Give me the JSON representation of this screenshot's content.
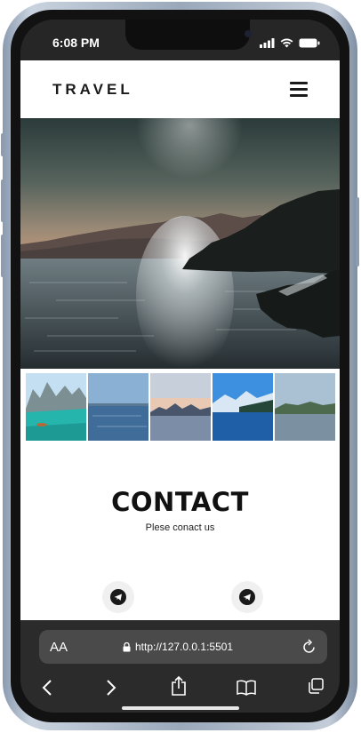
{
  "status_bar": {
    "time": "6:08 PM"
  },
  "site": {
    "brand": "TRAVEL"
  },
  "contact": {
    "heading": "CONTACT",
    "subtitle": "Plese conact us"
  },
  "browser": {
    "text_size_label": "AA",
    "url": "http://127.0.0.1:5501"
  },
  "icons": {
    "signal": "signal-icon",
    "wifi": "wifi-icon",
    "battery": "battery-icon",
    "menu": "hamburger-menu-icon",
    "social": "telegram-icon",
    "lock": "lock-icon",
    "reload": "reload-icon",
    "back": "chevron-left-icon",
    "forward": "chevron-right-icon",
    "share": "share-icon",
    "bookmarks": "book-icon",
    "tabs": "tabs-icon"
  },
  "colors": {
    "page_bg": "#ffffff",
    "text_dark": "#111111",
    "browser_chrome": "#2b2b2b",
    "url_field": "#4a4a4a"
  }
}
